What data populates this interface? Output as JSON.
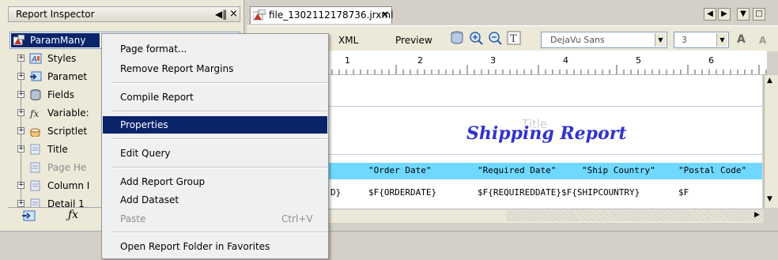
{
  "inspector": {
    "title": "Report Inspector",
    "pin_glyph": "◀‖",
    "close_glyph": "×",
    "report_selector": "ParamMany",
    "tree": [
      {
        "label": "Styles",
        "icon": "styles-icon",
        "expander": "+",
        "dim": false
      },
      {
        "label": "Paramet",
        "icon": "parameters-icon",
        "expander": "+",
        "dim": false
      },
      {
        "label": "Fields",
        "icon": "fields-icon",
        "expander": "+",
        "dim": false
      },
      {
        "label": "Variable:",
        "icon": "variables-icon",
        "expander": "+",
        "dim": false
      },
      {
        "label": "Scriptlet",
        "icon": "scriptlets-icon",
        "expander": "+",
        "dim": false
      },
      {
        "label": "Title",
        "icon": "band-icon",
        "expander": "+",
        "dim": false
      },
      {
        "label": "Page He",
        "icon": "band-icon",
        "expander": "",
        "dim": true
      },
      {
        "label": "Column I",
        "icon": "band-icon",
        "expander": "+",
        "dim": false
      },
      {
        "label": "Detail 1",
        "icon": "band-icon",
        "expander": "+",
        "dim": false
      }
    ]
  },
  "editor": {
    "tab_title": "file_1302112178736.jrxml",
    "tab_close": "×",
    "modes": [
      "XML",
      "Preview"
    ],
    "font_name": "DejaVu Sans",
    "font_size": "3",
    "ruler_numbers": [
      "1",
      "2",
      "3",
      "4",
      "5",
      "6"
    ],
    "report_title": "Shipping Report",
    "ghost_title": "Title",
    "column_headers": [
      "\"Order Date\"",
      "\"Required Date\"",
      "\"Ship Country\"",
      "\"Postal Code\""
    ],
    "fields": [
      "D}",
      "$F{ORDERDATE}",
      "$F{REQUIREDDATE}$F{SHIPCOUNTRY}",
      "$F"
    ]
  },
  "context_menu": {
    "items": [
      {
        "label": "Page format...",
        "shortcut": "",
        "disabled": false
      },
      {
        "label": "Remove Report Margins",
        "shortcut": "",
        "disabled": false
      },
      {
        "label": "Compile Report",
        "shortcut": "",
        "disabled": false
      },
      {
        "label": "Properties",
        "shortcut": "",
        "disabled": false,
        "highlighted": true
      },
      {
        "label": "Edit Query",
        "shortcut": "",
        "disabled": false
      },
      {
        "label": "Add Report Group",
        "shortcut": "",
        "disabled": false
      },
      {
        "label": "Add Dataset",
        "shortcut": "",
        "disabled": false
      },
      {
        "label": "Paste",
        "shortcut": "Ctrl+V",
        "disabled": true
      },
      {
        "label": "Open Report Folder in Favorites",
        "shortcut": "",
        "disabled": false
      }
    ]
  },
  "colors": {
    "selection": "#0a246a",
    "report_title": "#3333cc",
    "column_band": "#70d8ff"
  }
}
